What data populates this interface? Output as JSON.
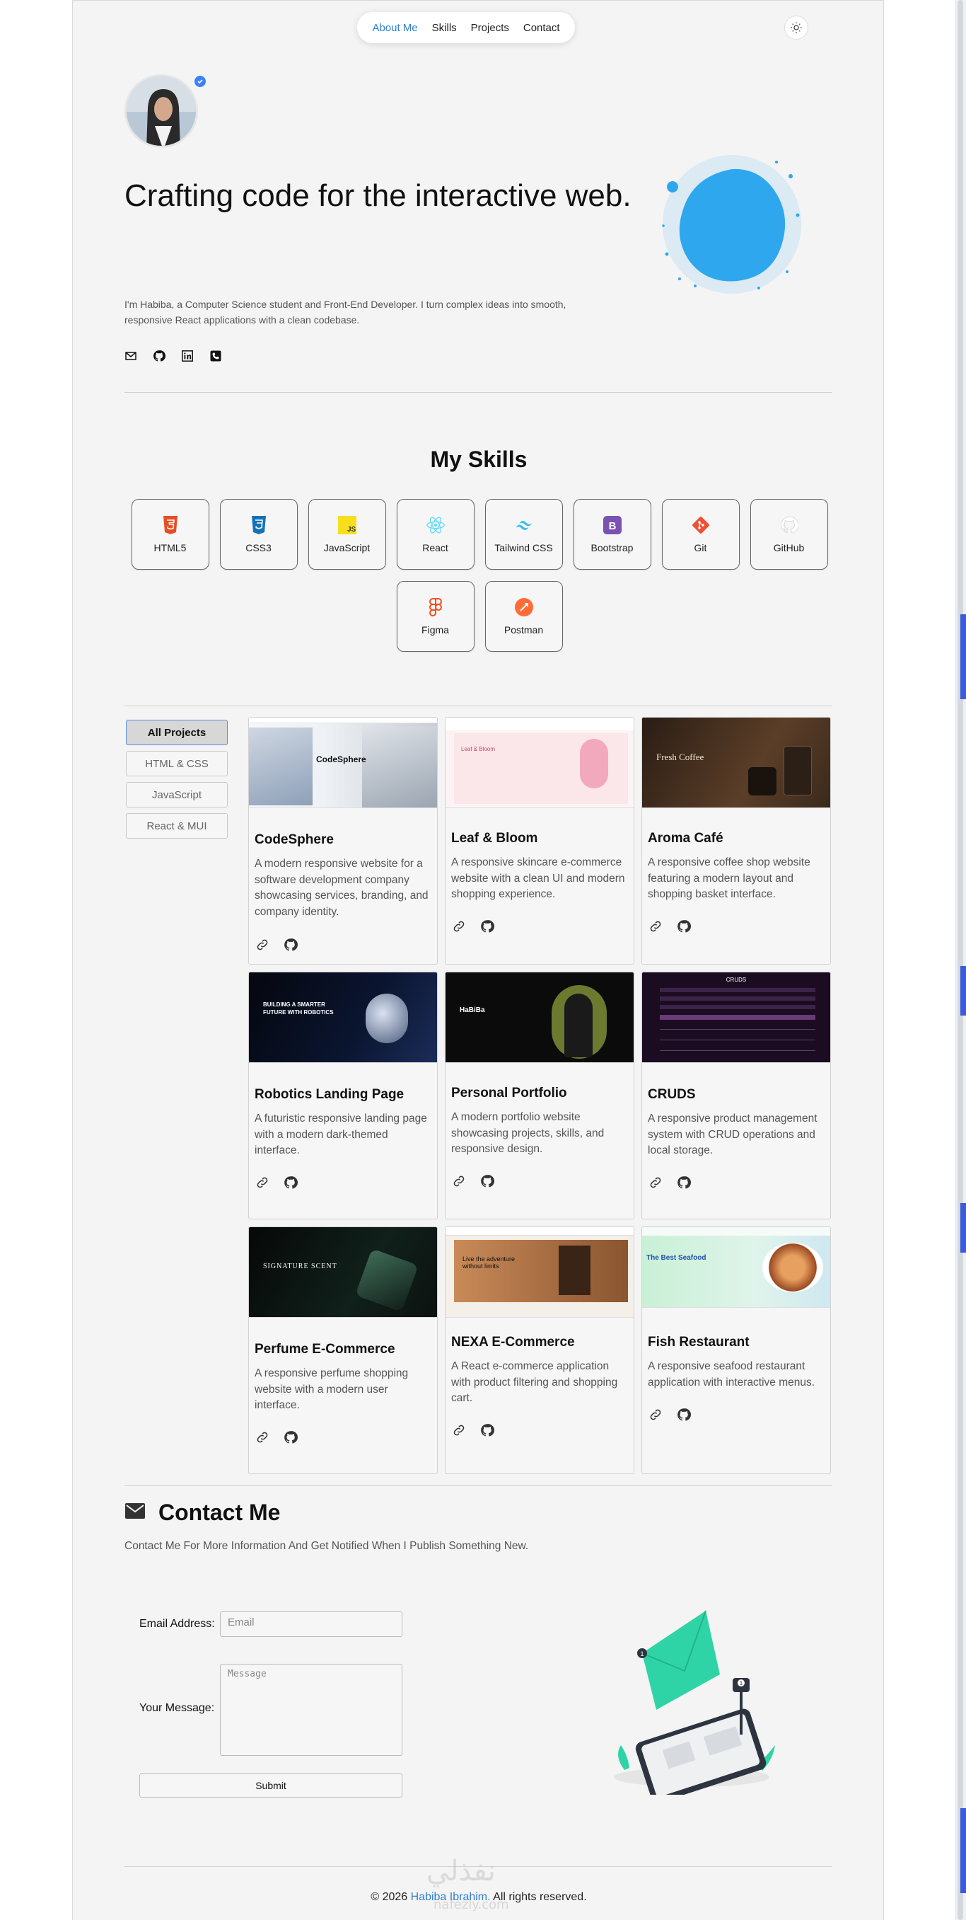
{
  "nav": {
    "items": [
      "About Me",
      "Skills",
      "Projects",
      "Contact"
    ],
    "theme_icon": "sun-icon"
  },
  "hero": {
    "title": "Crafting code for the interactive web.",
    "description": "I'm Habiba, a Computer Science student and Front-End Developer. I turn complex ideas into smooth, responsive React applications with a clean codebase.",
    "social_icons": [
      "mail-icon",
      "github-icon",
      "linkedin-icon",
      "phone-icon"
    ]
  },
  "skills": {
    "title": "My Skills",
    "items": [
      {
        "label": "HTML5",
        "icon": "html5-icon",
        "color": "#e34f26"
      },
      {
        "label": "CSS3",
        "icon": "css3-icon",
        "color": "#1572b6"
      },
      {
        "label": "JavaScript",
        "icon": "javascript-icon",
        "color": "#f7df1e"
      },
      {
        "label": "React",
        "icon": "react-icon",
        "color": "#61dafb"
      },
      {
        "label": "Tailwind CSS",
        "icon": "tailwind-icon",
        "color": "#38bdf8"
      },
      {
        "label": "Bootstrap",
        "icon": "bootstrap-icon",
        "color": "#7952b3"
      },
      {
        "label": "Git",
        "icon": "git-icon",
        "color": "#f05032"
      },
      {
        "label": "GitHub",
        "icon": "github-icon",
        "color": "#ffffff"
      },
      {
        "label": "Figma",
        "icon": "figma-icon",
        "color": "#f24e1e"
      },
      {
        "label": "Postman",
        "icon": "postman-icon",
        "color": "#ff6c37"
      }
    ]
  },
  "filters": [
    "All Projects",
    "HTML & CSS",
    "JavaScript",
    "React & MUI"
  ],
  "projects": [
    {
      "title": "CodeSphere",
      "desc": "A modern responsive website for a software development company showcasing services, branding, and company identity.",
      "thumb_text": "CodeSphere"
    },
    {
      "title": "Leaf & Bloom",
      "desc": "A responsive skincare e-commerce website with a clean UI and modern shopping experience.",
      "thumb_text": "Leaf & Bloom"
    },
    {
      "title": "Aroma Café",
      "desc": "A responsive coffee shop website featuring a modern layout and shopping basket interface.",
      "thumb_text": "Fresh Coffee"
    },
    {
      "title": "Robotics Landing Page",
      "desc": "A futuristic responsive landing page with a modern dark-themed interface.",
      "thumb_text": "BUILDING A SMARTER FUTURE WITH ROBOTICS"
    },
    {
      "title": "Personal Portfolio",
      "desc": "A modern portfolio website showcasing projects, skills, and responsive design.",
      "thumb_text": "HaBiBa"
    },
    {
      "title": "CRUDS",
      "desc": "A responsive product management system with CRUD operations and local storage.",
      "thumb_text": "CRUDS"
    },
    {
      "title": "Perfume E-Commerce",
      "desc": "A responsive perfume shopping website with a modern user interface.",
      "thumb_text": "SIGNATURE SCENT"
    },
    {
      "title": "NEXA E-Commerce",
      "desc": "A React e-commerce application with product filtering and shopping cart.",
      "thumb_text": "Live the adventure without limits"
    },
    {
      "title": "Fish Restaurant",
      "desc": "A responsive seafood restaurant application with interactive menus.",
      "thumb_text": "The Best Seafood"
    }
  ],
  "contact": {
    "title": "Contact Me",
    "subtitle": "Contact Me For More Information And Get Notified When I Publish Something New.",
    "email_label": "Email Address:",
    "email_placeholder": "Email",
    "message_label": "Your Message:",
    "message_placeholder": "Message",
    "submit_label": "Submit"
  },
  "footer": {
    "prefix": "© 2026 ",
    "name": "Habiba Ibrahim.",
    "suffix": " All rights reserved."
  },
  "watermark": {
    "arabic": "نفذلي",
    "latin": "nafezly.com"
  },
  "colors": {
    "accent": "#2f7fd1",
    "background": "#f4f4f4",
    "blob": "#3aa6ea"
  }
}
